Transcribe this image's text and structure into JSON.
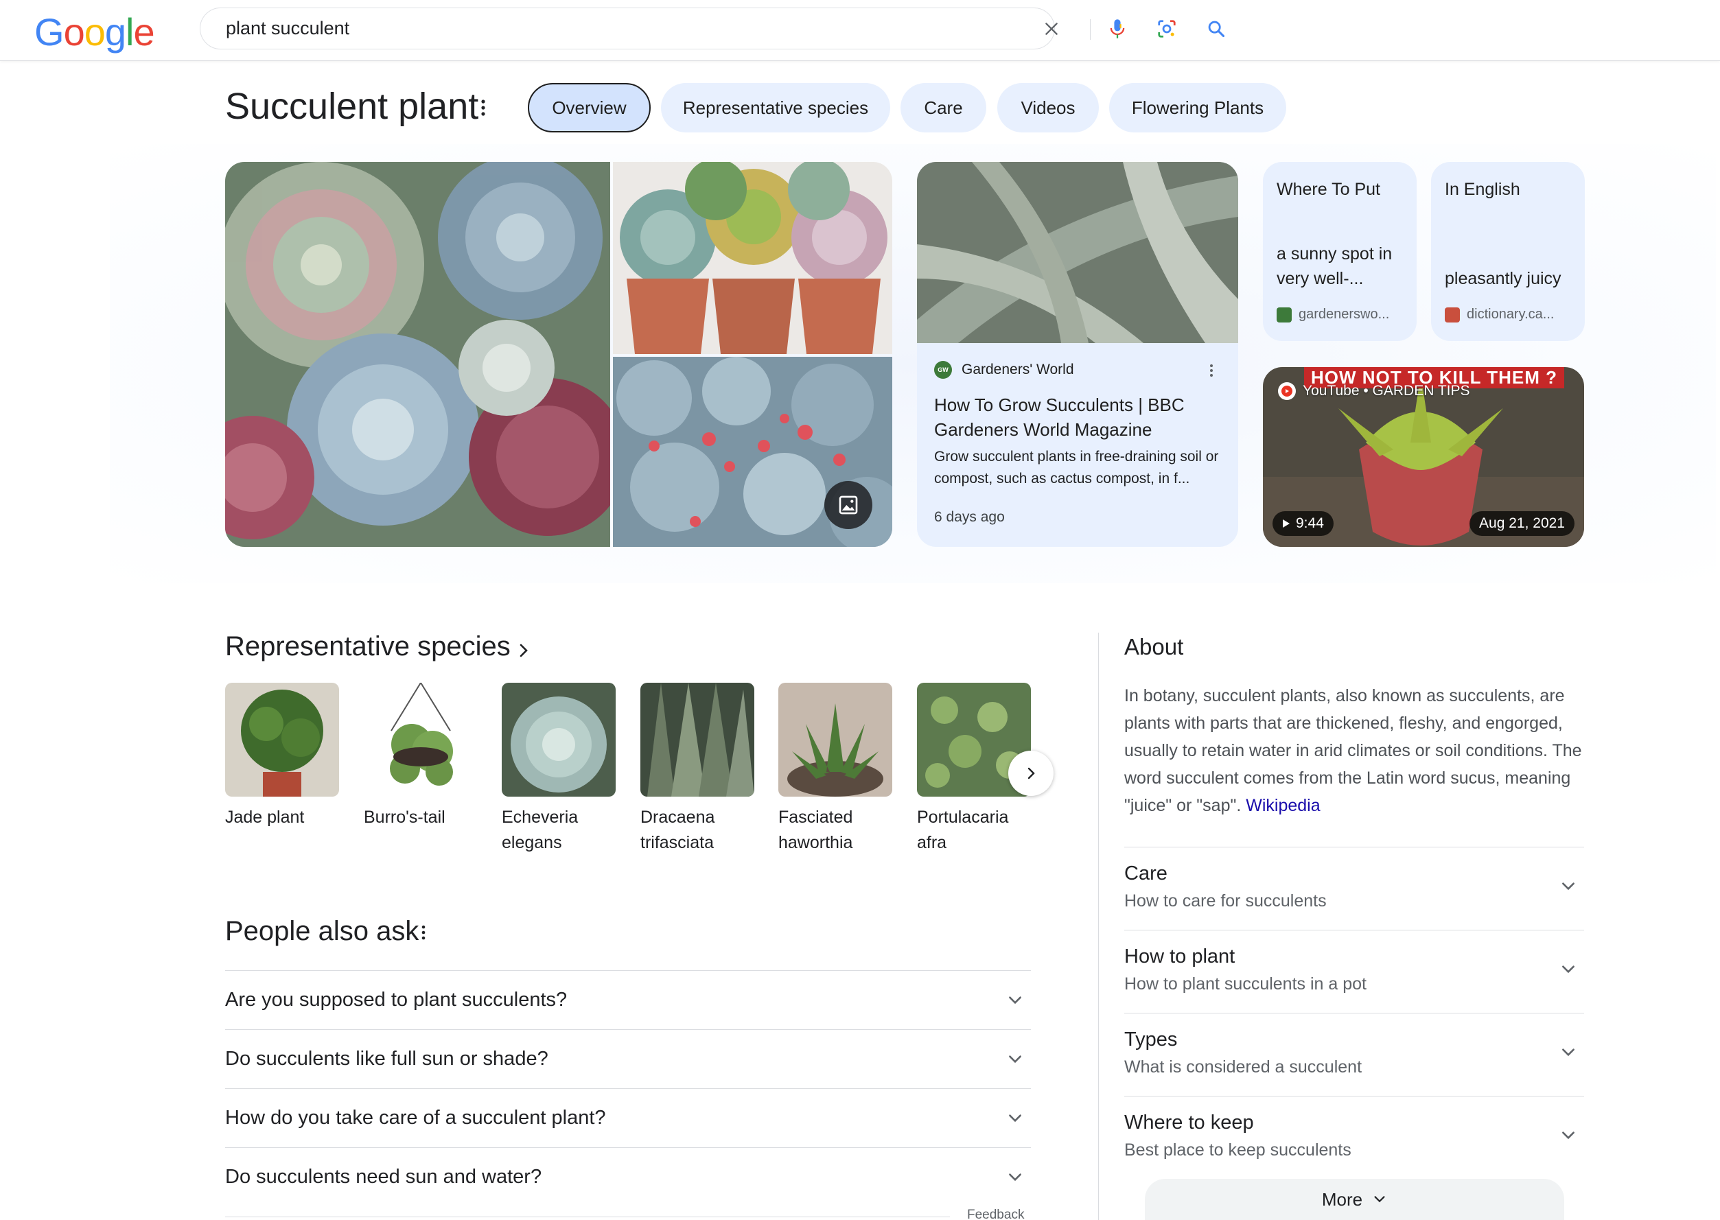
{
  "header": {
    "logo_letters": [
      "G",
      "o",
      "o",
      "g",
      "l",
      "e"
    ],
    "query": "plant succulent"
  },
  "entity": {
    "title": "Succulent plant",
    "chips": [
      {
        "label": "Overview",
        "active": true
      },
      {
        "label": "Representative species",
        "active": false
      },
      {
        "label": "Care",
        "active": false
      },
      {
        "label": "Videos",
        "active": false
      },
      {
        "label": "Flowering Plants",
        "active": false
      }
    ]
  },
  "hero": {
    "article": {
      "source": "Gardeners' World",
      "source_icon_text": "GW",
      "title": "How To Grow Succulents | BBC Gardeners World Magazine",
      "snippet": "Grow succulent plants in free-draining soil or compost, such as cactus compost, in f...",
      "date": "6 days ago"
    },
    "card_where": {
      "heading": "Where To Put",
      "body": "a sunny spot in very well-...",
      "source": "gardenerswo..."
    },
    "card_english": {
      "heading": "In English",
      "body": "pleasantly juicy",
      "source": "dictionary.ca..."
    },
    "video": {
      "banner": "HOW NOT TO KILL THEM ?",
      "source": "YouTube • GARDEN TIPS",
      "duration": "9:44",
      "date": "Aug 21, 2021"
    }
  },
  "species_section": {
    "title": "Representative species",
    "items": [
      {
        "name": "Jade plant"
      },
      {
        "name": "Burro's-tail"
      },
      {
        "name": "Echeveria elegans"
      },
      {
        "name": "Dracaena trifasciata"
      },
      {
        "name": "Fasciated haworthia"
      },
      {
        "name": "Portulacaria afra"
      }
    ]
  },
  "paa": {
    "title": "People also ask",
    "questions": [
      "Are you supposed to plant succulents?",
      "Do succulents like full sun or shade?",
      "How do you take care of a succulent plant?",
      "Do succulents need sun and water?"
    ],
    "feedback": "Feedback"
  },
  "about": {
    "title": "About",
    "text": "In botany, succulent plants, also known as succulents, are plants with parts that are thickened, fleshy, and engorged, usually to retain water in arid climates or soil conditions. The word succulent comes from the Latin word sucus, meaning \"juice\" or \"sap\".",
    "link": "Wikipedia",
    "accordions": [
      {
        "title": "Care",
        "subtitle": "How to care for succulents"
      },
      {
        "title": "How to plant",
        "subtitle": "How to plant succulents in a pot"
      },
      {
        "title": "Types",
        "subtitle": "What is considered a succulent"
      },
      {
        "title": "Where to keep",
        "subtitle": "Best place to keep succulents"
      }
    ],
    "more_label": "More"
  },
  "colors": {
    "brand_blue": "#4285f4",
    "chip_bg": "#e8f0fe",
    "link": "#1a0dab"
  },
  "icons": [
    "close-icon",
    "mic-icon",
    "lens-icon",
    "search-icon",
    "more-vert-icon",
    "image-icon",
    "chevron-right-icon",
    "chevron-down-icon",
    "play-icon",
    "youtube-icon"
  ]
}
